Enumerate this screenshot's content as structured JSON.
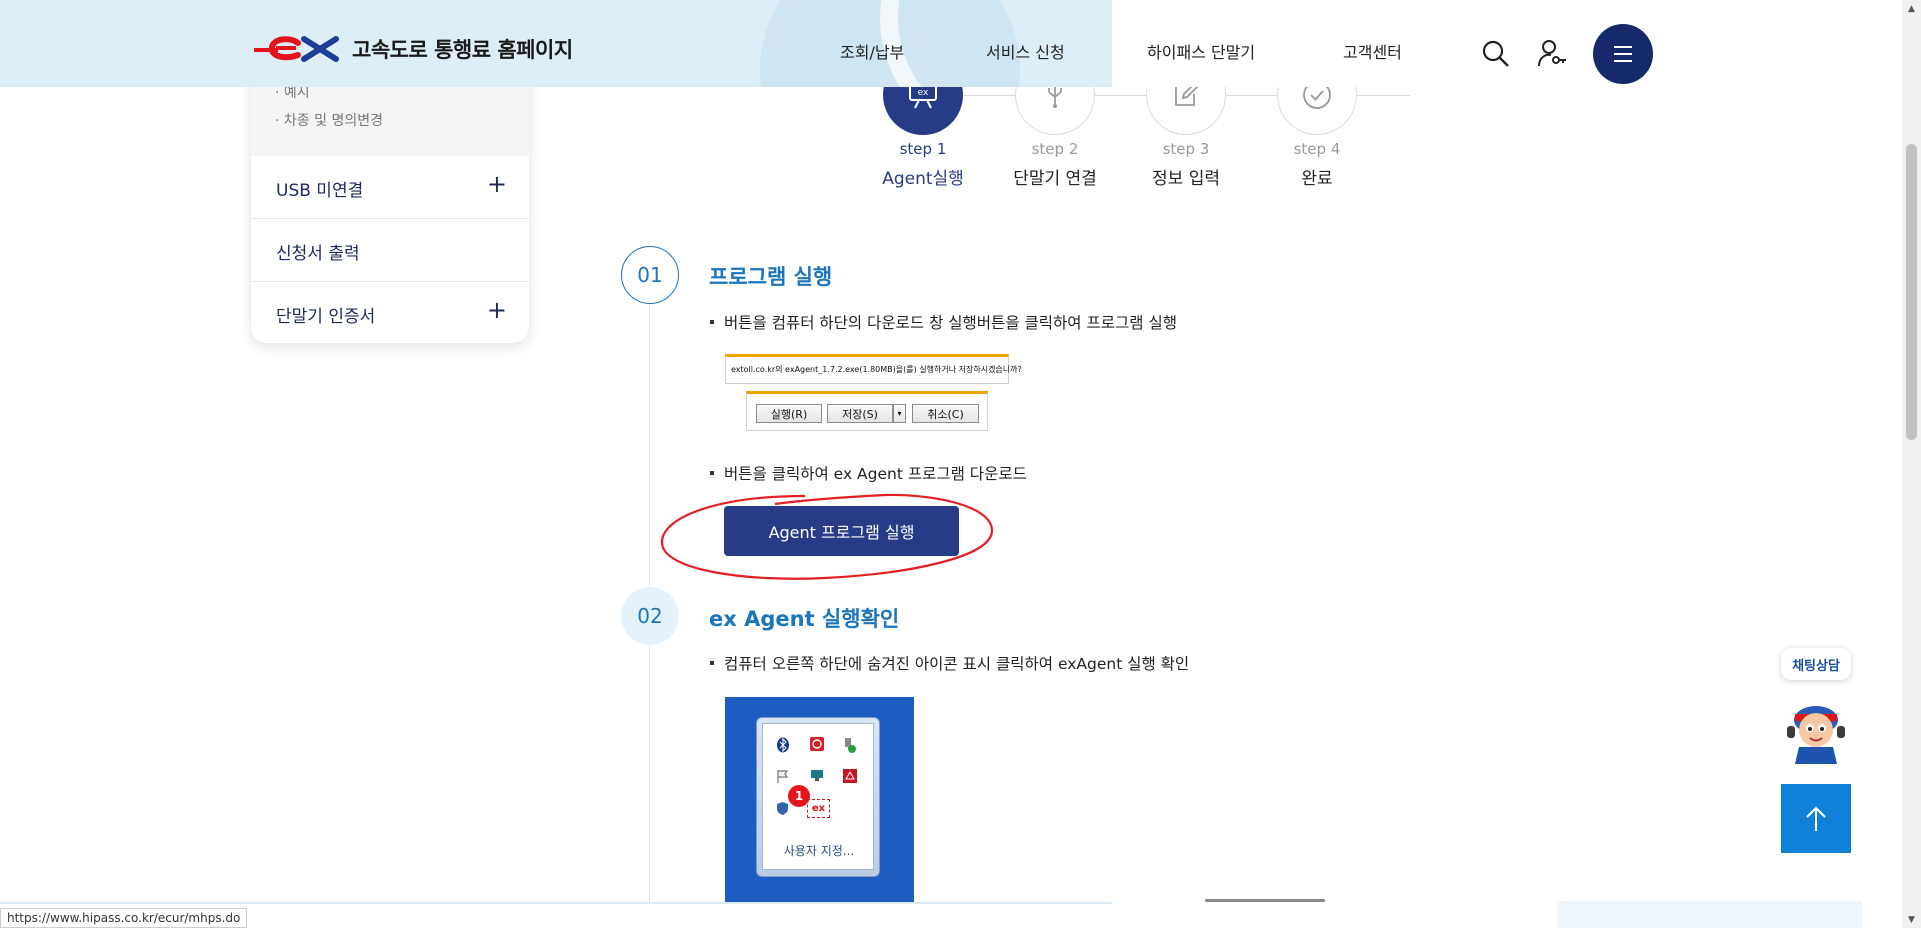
{
  "header": {
    "site_title": "고속도로 통행료 홈페이지",
    "nav": [
      "조회/납부",
      "서비스 신청",
      "하이패스 단말기",
      "고객센터"
    ]
  },
  "sidebar": {
    "sub_items": [
      "예시",
      "차종 및 명의변경"
    ],
    "items": [
      {
        "label": "USB 미연결",
        "expandable": "+"
      },
      {
        "label": "신청서 출력",
        "expandable": ""
      },
      {
        "label": "단말기 인증서",
        "expandable": "+"
      }
    ]
  },
  "steps": [
    {
      "num": "step 1",
      "name": "Agent실행",
      "active": true,
      "icon": "monitor-ex-icon"
    },
    {
      "num": "step 2",
      "name": "단말기 연결",
      "active": false,
      "icon": "usb-icon"
    },
    {
      "num": "step 3",
      "name": "정보 입력",
      "active": false,
      "icon": "edit-icon"
    },
    {
      "num": "step 4",
      "name": "완료",
      "active": false,
      "icon": "check-icon"
    }
  ],
  "section1": {
    "badge": "01",
    "title": "프로그램 실행",
    "bullet1": "버튼을 컴퓨터 하단의 다운로드 창 실행버튼을 클릭하여 프로그램 실행",
    "download_prompt": "extoll.co.kr의 exAgent_1.7.2.exe(1.80MB)을(를) 실행하거나 저장하시겠습니까?",
    "btn_run": "실행(R)",
    "btn_save": "저장(S)",
    "btn_cancel": "취소(C)",
    "bullet2": "버튼을 클릭하여 ex Agent 프로그램 다운로드",
    "agent_button": "Agent 프로그램 실행"
  },
  "section2": {
    "badge": "02",
    "title": "ex Agent 실행확인",
    "bullet1": "컴퓨터 오른쪽 하단에 숨겨진 아이콘 표시 클릭하여 exAgent 실행 확인",
    "tray_number": "1",
    "tray_ex": "ex",
    "tray_customize": "사용자 지정..."
  },
  "floating": {
    "chat_label": "채팅상담"
  },
  "status_url": "https://www.hipass.co.kr/ecur/mhps.do",
  "colors": {
    "brand_navy": "#273b86",
    "accent_blue": "#1b75bc",
    "logo_red": "#e3141b",
    "header_band": "#deeef6"
  }
}
